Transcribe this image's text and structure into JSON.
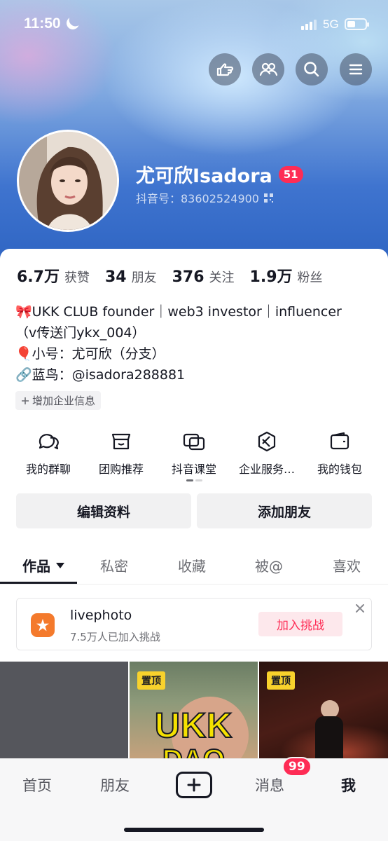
{
  "status_bar": {
    "time": "11:50",
    "network": "5G",
    "battery_level": 0.45
  },
  "top_actions": [
    {
      "icon": "hand-point-icon"
    },
    {
      "icon": "friends-icon"
    },
    {
      "icon": "search-icon"
    },
    {
      "icon": "menu-icon"
    }
  ],
  "profile": {
    "name": "尤可欣Isadora",
    "badge": "51",
    "douyin_id": "抖音号：83602524900"
  },
  "stats": [
    {
      "value": "6.7万",
      "label": "获赞"
    },
    {
      "value": "34",
      "label": "朋友"
    },
    {
      "value": "376",
      "label": "关注"
    },
    {
      "value": "1.9万",
      "label": "粉丝"
    }
  ],
  "bio": {
    "line1": "🎀UKK CLUB founder｜web3 investor｜influencer",
    "line2": "（v传送门ykx_004）",
    "line3": "🎈小号：尤可欣（分支）",
    "line4": "🔗蓝鸟：@isadora288881"
  },
  "add_business": "增加企业信息",
  "services": [
    {
      "label": "我的群聊",
      "icon": "group-chat-icon"
    },
    {
      "label": "团购推荐",
      "icon": "store-icon"
    },
    {
      "label": "抖音课堂",
      "icon": "classroom-icon"
    },
    {
      "label": "企业服务…",
      "icon": "enterprise-icon"
    },
    {
      "label": "我的钱包",
      "icon": "wallet-icon"
    }
  ],
  "actions": {
    "edit": "编辑资料",
    "add_friend": "添加朋友"
  },
  "tabs": [
    {
      "label": "作品",
      "active": true
    },
    {
      "label": "私密"
    },
    {
      "label": "收藏"
    },
    {
      "label": "被@"
    },
    {
      "label": "喜欢"
    }
  ],
  "challenge": {
    "title": "livephoto",
    "subtitle": "7.5万人已加入挑战",
    "join": "加入挑战"
  },
  "videos": [
    {
      "pinned": false
    },
    {
      "pinned": true,
      "pin_label": "置顶",
      "overlay_text": "UKK",
      "overlay_text2": "DAO"
    },
    {
      "pinned": true,
      "pin_label": "置顶"
    }
  ],
  "bottom_nav": {
    "home": "首页",
    "friends": "朋友",
    "messages": "消息",
    "messages_badge": "99",
    "me": "我"
  },
  "colors": {
    "accent": "#fe2c55",
    "pin": "#f8d22c",
    "challenge_icon": "#f47a2c"
  }
}
